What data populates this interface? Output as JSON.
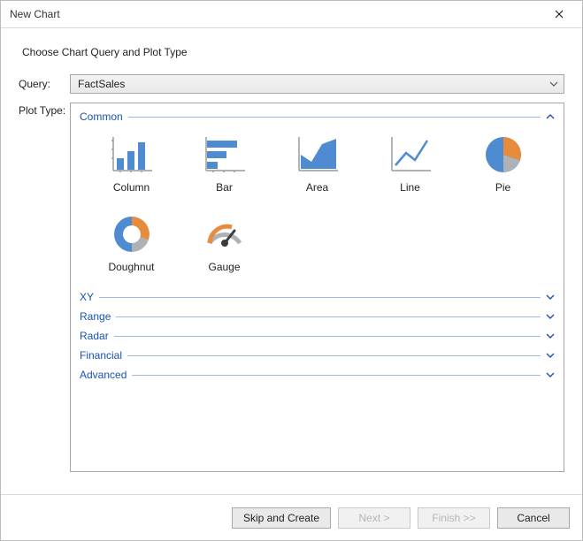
{
  "window": {
    "title": "New Chart"
  },
  "heading": "Choose Chart Query and Plot Type",
  "labels": {
    "query": "Query:",
    "plot_type": "Plot Type:"
  },
  "query": {
    "selected": "FactSales"
  },
  "sections": {
    "common": {
      "title": "Common",
      "expanded": true,
      "items": [
        {
          "id": "column",
          "label": "Column"
        },
        {
          "id": "bar",
          "label": "Bar"
        },
        {
          "id": "area",
          "label": "Area"
        },
        {
          "id": "line",
          "label": "Line"
        },
        {
          "id": "pie",
          "label": "Pie"
        },
        {
          "id": "doughnut",
          "label": "Doughnut"
        },
        {
          "id": "gauge",
          "label": "Gauge"
        }
      ]
    },
    "xy": {
      "title": "XY",
      "expanded": false
    },
    "range": {
      "title": "Range",
      "expanded": false
    },
    "radar": {
      "title": "Radar",
      "expanded": false
    },
    "financial": {
      "title": "Financial",
      "expanded": false
    },
    "advanced": {
      "title": "Advanced",
      "expanded": false
    }
  },
  "buttons": {
    "skip_create": "Skip and Create",
    "next": "Next >",
    "finish": "Finish >>",
    "cancel": "Cancel"
  },
  "button_state": {
    "next_enabled": false,
    "finish_enabled": false
  },
  "colors": {
    "accent_blue": "#4f8bd1",
    "accent_orange": "#e78b3c",
    "accent_gray": "#aeb1b5",
    "axis": "#9a9a9a",
    "link": "#1852b5"
  }
}
